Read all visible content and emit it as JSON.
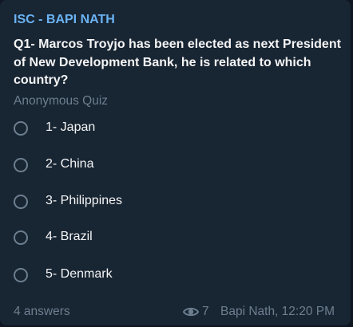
{
  "message": {
    "sender": "ISC - BAPI NATH",
    "question": "Q1- Marcos Troyjo has been elected as next President of New Development Bank, he is related to which country?",
    "quiz_type": "Anonymous Quiz",
    "options": [
      {
        "label": "1- Japan"
      },
      {
        "label": "2- China"
      },
      {
        "label": "3- Philippines"
      },
      {
        "label": "4- Brazil"
      },
      {
        "label": "5- Denmark"
      }
    ],
    "answers": "4 answers",
    "views": "7",
    "signature": "Bapi Nath, 12:20 PM",
    "eye_icon": "eye-icon"
  },
  "colors": {
    "background": "#0e1621",
    "bubble": "#182533",
    "sender": "#6ab3f3",
    "text": "#f5f5f5",
    "muted": "#6d7f8f"
  }
}
